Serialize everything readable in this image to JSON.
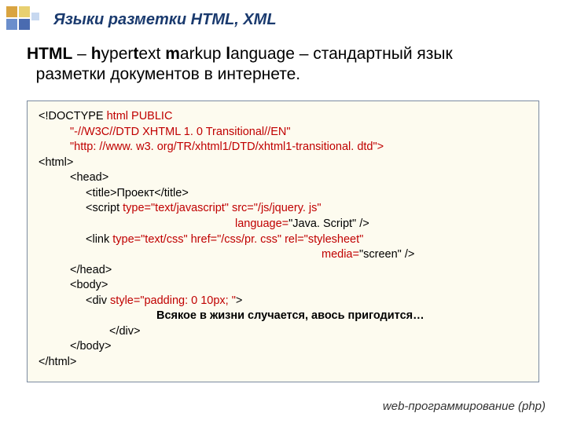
{
  "header": {
    "title": "Языки разметки HTML, XML"
  },
  "intro": {
    "prefix": "HTML",
    "dash1": " – ",
    "h": "h",
    "yper": "yper",
    "t": "t",
    "ext": "ext ",
    "m": "m",
    "arkup": "arkup ",
    "l": "l",
    "anguage": "anguage – стандартный язык",
    "line2": "разметки документов в интернете."
  },
  "code": {
    "l01a": "<!DOCTYPE",
    "l01b": " html PUBLIC",
    "l02": "\"-//W3C//DTD XHTML 1. 0 Transitional//EN\"",
    "l03": "\"http: //www. w3. org/TR/xhtml1/DTD/xhtml1-transitional. dtd\">",
    "l04": "<html>",
    "l05": "<head>",
    "l06": "<title>Проект</title>",
    "l07a": "<script ",
    "l07b": "type=\"text/javascript\" src=\"/js/jquery. js\"",
    "l08a": "language=",
    "l08b": "\"Java. Script\" />",
    "l09a": "<link ",
    "l09b": "type=\"text/css\" href=\"/css/pr. css\" rel=\"stylesheet\"",
    "l10a": "media=",
    "l10b": "\"screen\" />",
    "l11": "</head>",
    "l12": "<body>",
    "l13a": "<div ",
    "l13b": "style=\"padding: 0 10px; \"",
    "l13c": ">",
    "l14": "Всякое в жизни случается, авось пригодится…",
    "l15": "</div>",
    "l16": "</body>",
    "l17": "</html>"
  },
  "footer": {
    "text": "web-программирование (php)"
  }
}
